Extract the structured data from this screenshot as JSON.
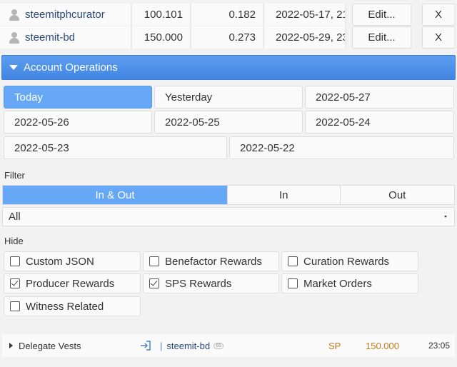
{
  "delegations": [
    {
      "user": "steemitphcurator",
      "sp": "100.101",
      "vests_ratio": "0.182",
      "date": "2022-05-17, 21:",
      "edit_label": "Edit...",
      "remove_label": "X"
    },
    {
      "user": "steemit-bd",
      "sp": "150.000",
      "vests_ratio": "0.273",
      "date": "2022-05-29, 23:",
      "edit_label": "Edit...",
      "remove_label": "X"
    }
  ],
  "account_operations": {
    "title": "Account Operations",
    "dates": [
      "Today",
      "Yesterday",
      "2022-05-27",
      "2022-05-26",
      "2022-05-25",
      "2022-05-24",
      "2022-05-23",
      "2022-05-22"
    ],
    "selected_date": "Today",
    "filter_label": "Filter",
    "filter_tabs": [
      "In & Out",
      "In",
      "Out"
    ],
    "selected_filter": "In & Out",
    "type_select_value": "All",
    "hide_label": "Hide",
    "hide_options": [
      {
        "label": "Custom JSON",
        "checked": false
      },
      {
        "label": "Benefactor Rewards",
        "checked": false
      },
      {
        "label": "Curation Rewards",
        "checked": false
      },
      {
        "label": "Producer Rewards",
        "checked": true
      },
      {
        "label": "SPS Rewards",
        "checked": true
      },
      {
        "label": "Market Orders",
        "checked": false
      },
      {
        "label": "Witness Related",
        "checked": false
      }
    ]
  },
  "operations": [
    {
      "type": "Delegate Vests",
      "separator": "|",
      "user": "steemit-bd",
      "badge": "65",
      "unit": "SP",
      "amount": "150.000",
      "time": "23:05"
    }
  ],
  "colors": {
    "accent": "#4a8fe8",
    "active_button": "#66a8f6",
    "amount": "#c87a1a",
    "link": "#2a4b7c"
  }
}
